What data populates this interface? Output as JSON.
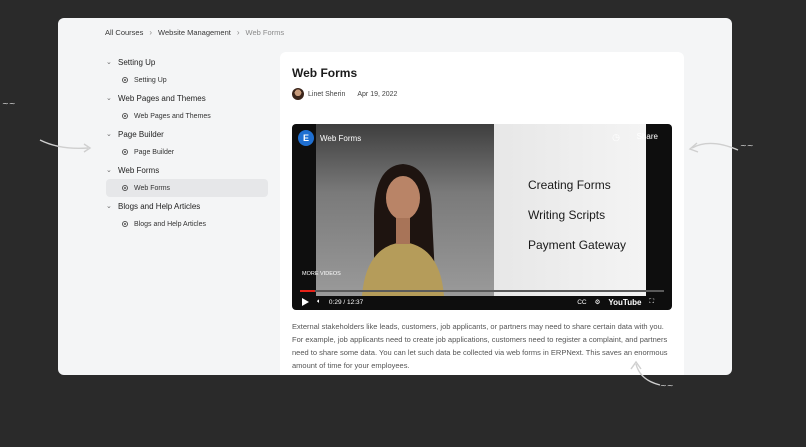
{
  "breadcrumb": [
    "All Courses",
    "Website Management",
    "Web Forms"
  ],
  "sidebar": [
    {
      "title": "Setting Up",
      "lessons": [
        {
          "label": "Setting Up",
          "active": false
        }
      ]
    },
    {
      "title": "Web Pages and Themes",
      "lessons": [
        {
          "label": "Web Pages and Themes",
          "active": false
        }
      ]
    },
    {
      "title": "Page Builder",
      "lessons": [
        {
          "label": "Page Builder",
          "active": false
        }
      ]
    },
    {
      "title": "Web Forms",
      "lessons": [
        {
          "label": "Web Forms",
          "active": true
        }
      ]
    },
    {
      "title": "Blogs and Help Articles",
      "lessons": [
        {
          "label": "Blogs and Help Articles",
          "active": false
        }
      ]
    }
  ],
  "lesson": {
    "title": "Web Forms",
    "author": "Linet Sherin",
    "date": "Apr 19, 2022",
    "video": {
      "title": "Web Forms",
      "logo_letter": "E",
      "share_label": "Share",
      "slides": [
        "Creating Forms",
        "Writing Scripts",
        "Payment Gateway"
      ],
      "more_videos": "MORE VIDEOS",
      "time": "0:29 / 12:37",
      "progress": 0.04,
      "youtube": "YouTube",
      "cc": "CC"
    },
    "description": "External stakeholders like leads, customers, job applicants, or partners may need to share certain data with you. For example, job applicants need to create job applications, customers need to register a complaint, and partners need to share some data. You can let such data be collected via web forms in ERPNext. This saves an enormous amount of time for your employees."
  },
  "colors": {
    "accent": "#e62117",
    "logo": "#1f6fd1",
    "frame": "#f4f5f6"
  }
}
